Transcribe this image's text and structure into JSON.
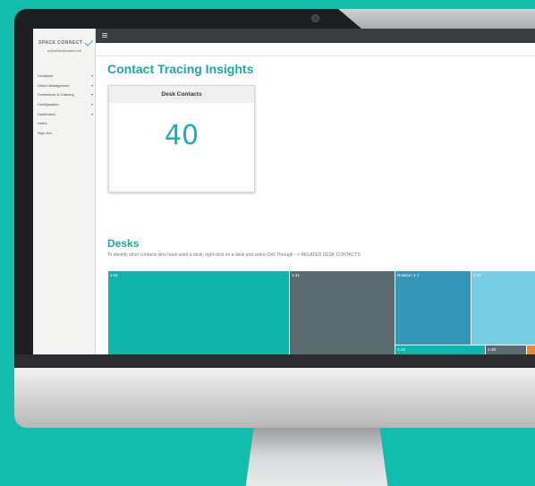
{
  "brand": {
    "name": "SPACE CONNECT",
    "icon": "check-logo-icon",
    "color": "#5fb8d6"
  },
  "user": {
    "email": "sc@admin@scdemo.net"
  },
  "sidebar": {
    "items": [
      {
        "label": "Locations",
        "caret": "▾"
      },
      {
        "label": "Visitor Management",
        "caret": "▾"
      },
      {
        "label": "Conference & Catering",
        "caret": "▾"
      },
      {
        "label": "Configuration",
        "caret": "▾"
      },
      {
        "label": "Dashboard",
        "caret": "▾"
      },
      {
        "label": "Users",
        "caret": ""
      },
      {
        "label": "Sign Out",
        "caret": ""
      }
    ]
  },
  "page": {
    "title": "Contact Tracing Insights",
    "card": {
      "title": "Desk Contacts",
      "value": "40"
    },
    "desks": {
      "title": "Desks",
      "description": "To identify other contacts who have used a desk, right-click on a desk and select Drill Through --> RELATED DESK CONTACTS",
      "tiles": [
        {
          "label": "1-01",
          "color": "#0fb5a8"
        },
        {
          "label": "1-31",
          "color": "#5a6b70"
        },
        {
          "label": "Rotation 1-1",
          "color": "#3296b8"
        },
        {
          "label": "1-07",
          "color": "#78cde6"
        },
        {
          "label": "1-12",
          "color": "#0fb5a8"
        },
        {
          "label": "1-38",
          "color": "#5a6b70"
        },
        {
          "label": "",
          "color": "#e8873a"
        }
      ]
    }
  },
  "colors": {
    "accent": "#1aa9a5",
    "topbar": "#3a3d40",
    "background": "#12bdad"
  }
}
